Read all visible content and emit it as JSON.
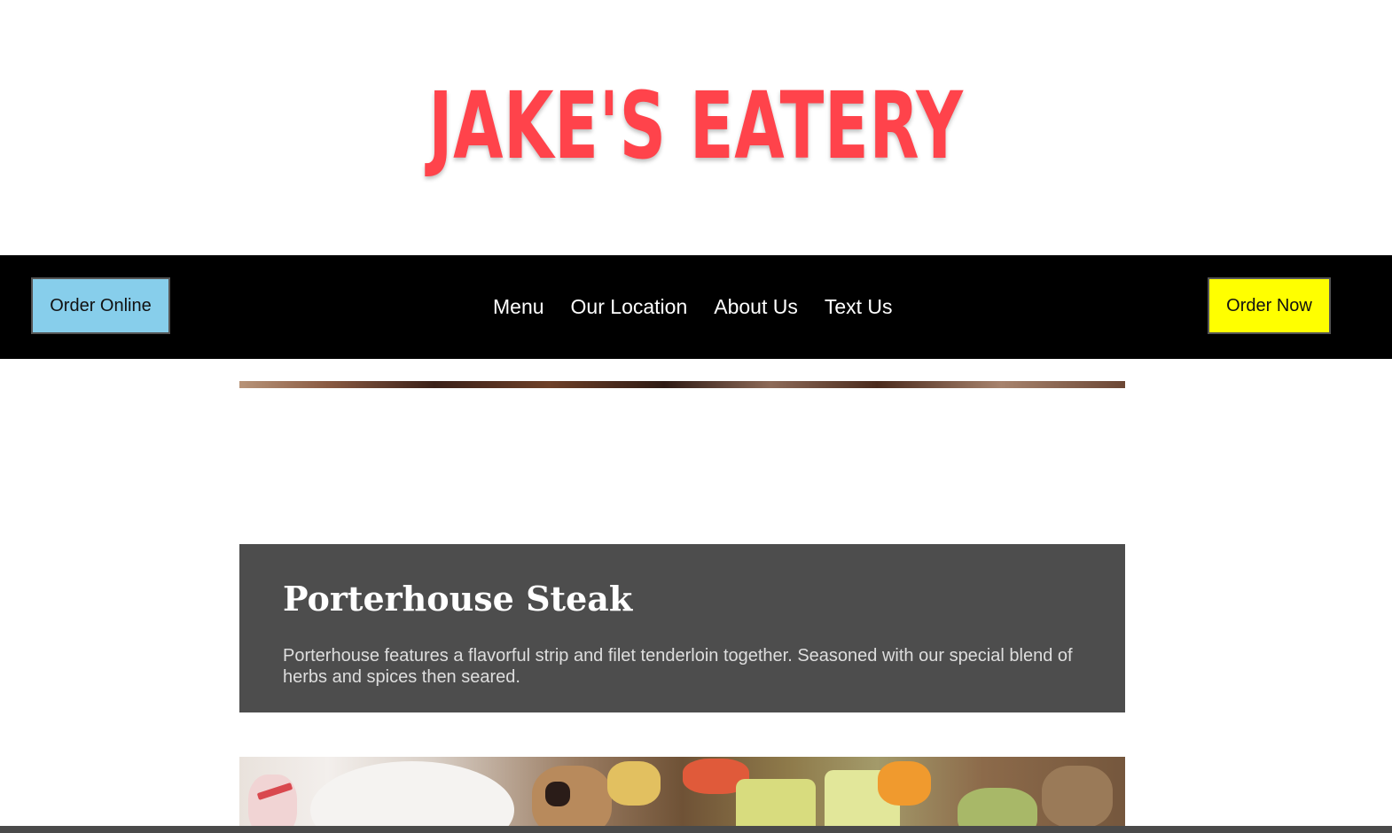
{
  "header": {
    "logo_text": "JAKE'S EATERY"
  },
  "navbar": {
    "order_online_label": "Order Online",
    "links": [
      {
        "label": "Menu"
      },
      {
        "label": "Our Location"
      },
      {
        "label": "About Us"
      },
      {
        "label": "Text Us"
      }
    ],
    "order_now_label": "Order Now"
  },
  "menu_item": {
    "title": "Porterhouse Steak",
    "description": "Porterhouse features a flavorful strip and filet tenderloin together. Seasoned with our special blend of herbs and spices then seared."
  },
  "colors": {
    "logo": "#ff434b",
    "navbar_bg": "#000000",
    "order_online_bg": "#87ceeb",
    "order_now_bg": "#ffff00",
    "card_bg": "#4d4d4d"
  }
}
